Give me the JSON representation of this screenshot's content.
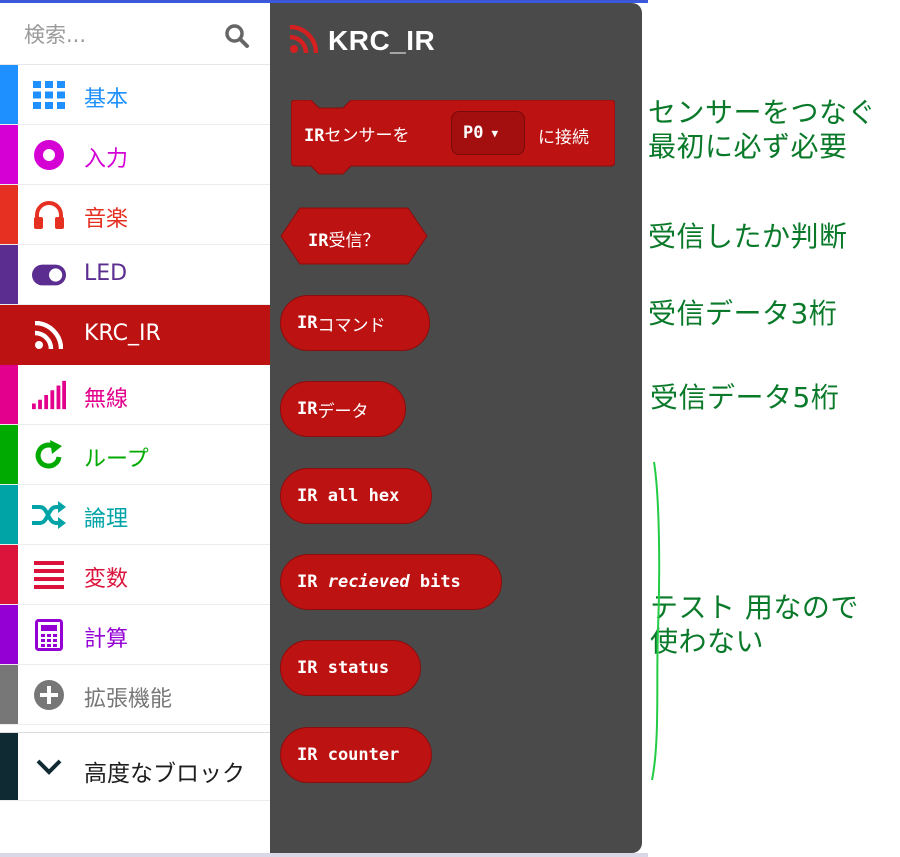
{
  "search": {
    "placeholder": "検索..."
  },
  "categories": [
    {
      "label": "基本",
      "color": "#1e90ff",
      "icon": "grid-icon"
    },
    {
      "label": "入力",
      "color": "#d400d4",
      "icon": "target-icon"
    },
    {
      "label": "音楽",
      "color": "#e63022",
      "icon": "headphones-icon"
    },
    {
      "label": "LED",
      "color": "#5c2d91",
      "icon": "toggle-icon"
    },
    {
      "label": "KRC_IR",
      "color": "#bd1212",
      "icon": "rss-icon"
    },
    {
      "label": "無線",
      "color": "#e3008c",
      "icon": "signal-bars-icon"
    },
    {
      "label": "ループ",
      "color": "#00aa00",
      "icon": "loop-arrow-icon"
    },
    {
      "label": "論理",
      "color": "#00a4a6",
      "icon": "shuffle-icon"
    },
    {
      "label": "変数",
      "color": "#dc143c",
      "icon": "lines-icon"
    },
    {
      "label": "計算",
      "color": "#9400d3",
      "icon": "calculator-icon"
    },
    {
      "label": "拡張機能",
      "color": "#777777",
      "icon": "plus-circle-icon"
    }
  ],
  "advanced": {
    "label": "高度なブロック",
    "color": "#0f2a33",
    "icon": "chevron-down-icon"
  },
  "flyout": {
    "title": "KRC_IR",
    "connect_block": {
      "prefix": "IR",
      "text1": "センサーを",
      "dropdown": "P0",
      "text2": "に接続"
    },
    "received_block": {
      "prefix": "IR",
      "text": "受信？"
    },
    "command_block": {
      "prefix": "IR",
      "text": "コマンド"
    },
    "data_block": {
      "prefix": "IR",
      "text": "データ"
    },
    "hex_block": "IR all hex",
    "bits_block": {
      "prefix": "IR ",
      "italic": "recieved",
      "suffix": " bits"
    },
    "status_block": "IR status",
    "counter_block": "IR counter"
  },
  "annotations": {
    "connect_line1": "センサーをつなぐ",
    "connect_line2": "最初に必ず必要",
    "received": "受信したか判断",
    "command": "受信データ3桁",
    "data": "受信データ5桁",
    "test_line1": "テスト 用なので",
    "test_line2": "使わない"
  },
  "colors": {
    "accent": "#bd1212",
    "flyout_bg": "#4a4a4b",
    "annotation": "#0a7a2a"
  }
}
